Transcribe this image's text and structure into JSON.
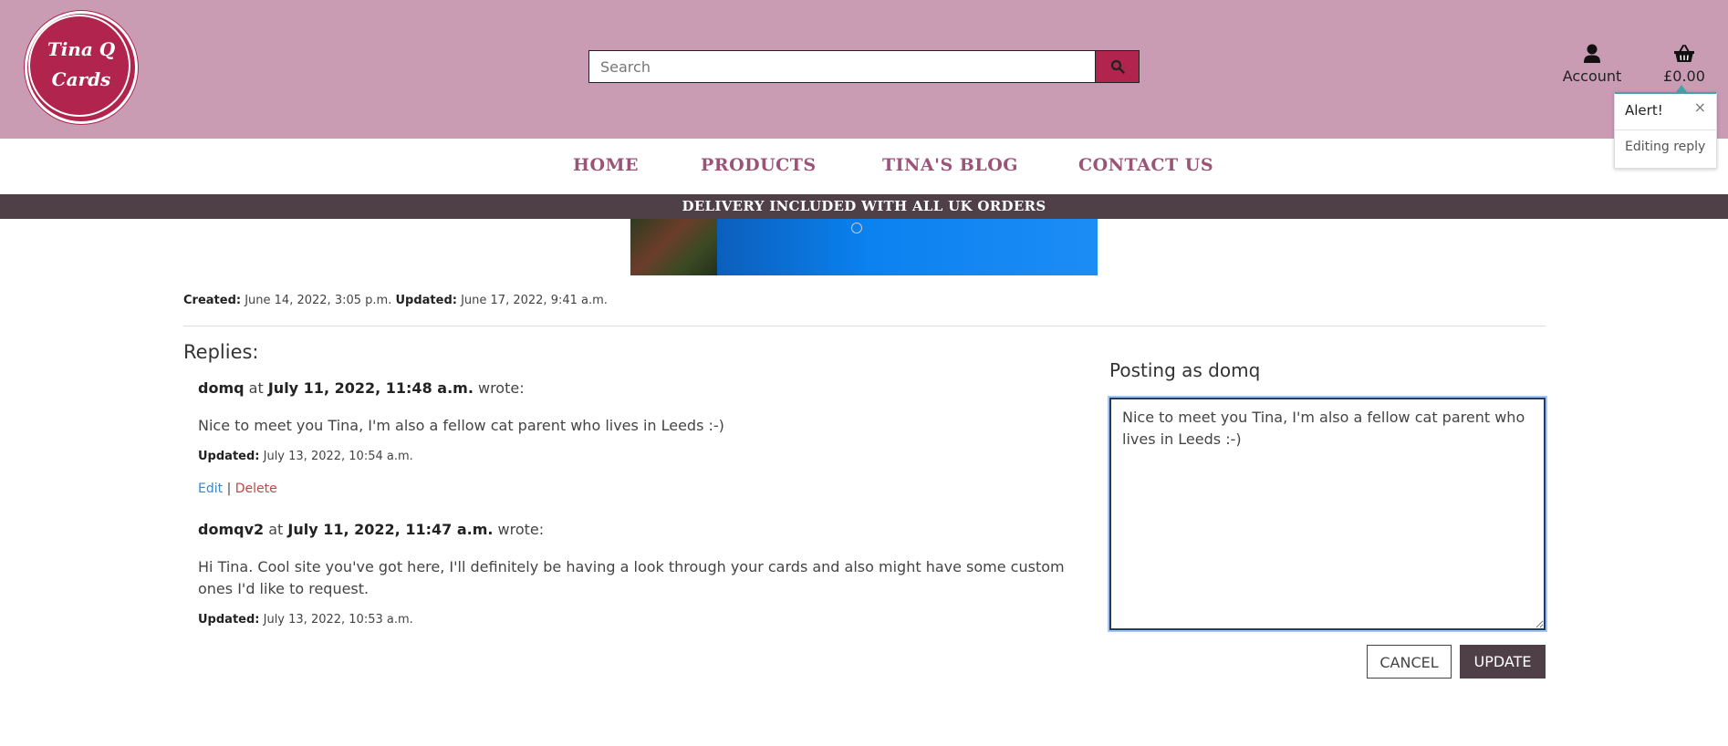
{
  "header": {
    "logo_line1": "Tina Q",
    "logo_line2": "Cards",
    "search": {
      "placeholder": "Search"
    },
    "account_label": "Account",
    "cart_total": "£0.00"
  },
  "nav": {
    "items": [
      "HOME",
      "PRODUCTS",
      "TINA'S BLOG",
      "CONTACT US"
    ]
  },
  "banner": "DELIVERY INCLUDED WITH ALL UK ORDERS",
  "post_meta": {
    "created_label": "Created:",
    "created_value": "June 14, 2022, 3:05 p.m.",
    "updated_label": "Updated:",
    "updated_value": "June 17, 2022, 9:41 a.m."
  },
  "replies": {
    "title": "Replies:",
    "items": [
      {
        "author": "domq",
        "at": "at",
        "date": "July 11, 2022, 11:48 a.m.",
        "wrote": "wrote:",
        "body": "Nice to meet you Tina, I'm also a fellow cat parent who lives in Leeds :-)",
        "updated_label": "Updated:",
        "updated_value": "July 13, 2022, 10:54 a.m.",
        "edit": "Edit",
        "separator": "|",
        "delete": "Delete"
      },
      {
        "author": "domqv2",
        "at": "at",
        "date": "July 11, 2022, 11:47 a.m.",
        "wrote": "wrote:",
        "body": "Hi Tina. Cool site you've got here, I'll definitely be having a look through your cards and also might have some custom ones I'd like to request.",
        "updated_label": "Updated:",
        "updated_value": "July 13, 2022, 10:53 a.m."
      }
    ]
  },
  "form": {
    "posting_as": "Posting as domq",
    "textarea_value": "Nice to meet you Tina, I'm also a fellow cat parent who lives in Leeds :-)",
    "cancel_label": "CANCEL",
    "update_label": "UPDATE"
  },
  "toast": {
    "title": "Alert!",
    "close": "×",
    "message": "Editing reply"
  },
  "colors": {
    "header_bg": "#ca9cb4",
    "brand": "#b0244e",
    "nav_text": "#9b5478",
    "banner_bg": "#4f3f47",
    "link_edit": "#3b87c9",
    "link_delete": "#c24646"
  }
}
